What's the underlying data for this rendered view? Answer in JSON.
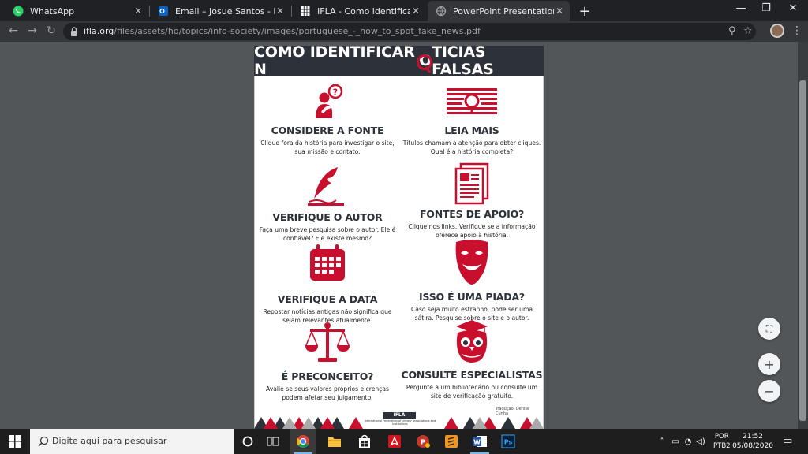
{
  "browser": {
    "tabs": [
      {
        "title": "WhatsApp",
        "active": false
      },
      {
        "title": "Email – Josue Santos - BIBLIOTEC",
        "active": false
      },
      {
        "title": "IFLA - Como identificar notícias f",
        "active": false
      },
      {
        "title": "PowerPoint Presentation",
        "active": true
      }
    ],
    "url_domain": "ifla.org",
    "url_path": "/files/assets/hq/topics/info-society/images/portuguese_-_how_to_spot_fake_news.pdf"
  },
  "poster": {
    "title_before": "COMO IDENTIFICAR N",
    "title_o": "O",
    "title_after": "TÍCIAS FALSAS",
    "items": [
      {
        "heading": "CONSIDERE A FONTE",
        "text": "Clique fora da história para investigar o site, sua missão e contato."
      },
      {
        "heading": "LEIA MAIS",
        "text": "Títulos chamam a atenção para obter cliques. Qual é a história completa?"
      },
      {
        "heading": "VERIFIQUE O AUTOR",
        "text": "Faça uma breve pesquisa sobre o autor. Ele é confiável? Ele existe mesmo?"
      },
      {
        "heading": "FONTES DE APOIO?",
        "text": "Clique nos links. Verifique se a informação oferece apoio à história."
      },
      {
        "heading": "VERIFIQUE A DATA",
        "text": "Repostar notícias antigas não significa que sejam relevantes atualmente."
      },
      {
        "heading": "ISSO É UMA PIADA?",
        "text": "Caso seja muito estranho, pode ser uma sátira. Pesquise sobre o site e o autor."
      },
      {
        "heading": "É PRECONCEITO?",
        "text": "Avalie se seus valores próprios e crenças podem afetar seu julgamento."
      },
      {
        "heading": "CONSULTE ESPECIALISTAS",
        "text": "Pergunte a um bibliotecário ou consulte um site de verificação gratuito."
      }
    ],
    "credit": "Tradução: Denise Cunha",
    "logo": "IFLA",
    "logo_sub": "International Federation of Library Associations and Institutions"
  },
  "taskbar": {
    "search_placeholder": "Digite aqui para pesquisar",
    "lang_top": "POR",
    "lang_bottom": "PTB2",
    "time": "21:52",
    "date": "05/08/2020"
  },
  "colors": {
    "accent_red": "#c8102e",
    "dark_navy": "#2d3139"
  }
}
